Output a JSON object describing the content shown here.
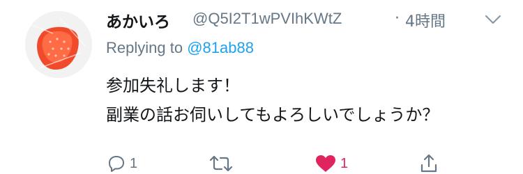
{
  "tweet": {
    "display_name": "あかいろ",
    "handle": "@Q5I2T1wPVIhKWtZ",
    "separator": "·",
    "timestamp": "4時間",
    "replying_prefix": "Replying to",
    "replying_handle": "@81ab88",
    "body_lines": [
      "参加失礼します！",
      "副業の話お伺いしてもよろしいでしょうか？"
    ],
    "actions": {
      "reply_count": "1",
      "retweet_count": "",
      "like_count": "1"
    }
  },
  "colors": {
    "secondary_text": "#657786",
    "link": "#1da1f2",
    "like": "#e0245e",
    "icon": "#657786"
  },
  "icons": {
    "avatar": "strawberry-avatar",
    "menu": "chevron-down-icon",
    "reply": "reply-icon",
    "retweet": "retweet-icon",
    "like": "heart-icon",
    "share": "share-icon"
  }
}
